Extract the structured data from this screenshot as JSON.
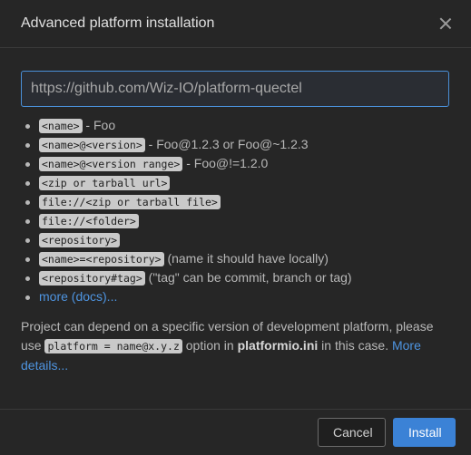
{
  "dialog": {
    "title": "Advanced platform installation",
    "url_value": "https://github.com/Wiz-IO/platform-quectel",
    "hints": [
      {
        "code": "<name>",
        "text": " - Foo"
      },
      {
        "code": "<name>@<version>",
        "text": " - Foo@1.2.3 or Foo@~1.2.3"
      },
      {
        "code": "<name>@<version range>",
        "text": " - Foo@!=1.2.0"
      },
      {
        "code": "<zip or tarball url>",
        "text": ""
      },
      {
        "code": "file://<zip or tarball file>",
        "text": ""
      },
      {
        "code": "file://<folder>",
        "text": ""
      },
      {
        "code": "<repository>",
        "text": ""
      },
      {
        "code": "<name>=<repository>",
        "text": " (name it should have locally)"
      },
      {
        "code": "<repository#tag>",
        "text": " (\"tag\" can be commit, branch or tag)"
      }
    ],
    "more_docs_link": "more (docs)...",
    "note": {
      "text1": "Project can depend on a specific version of development platform, please use ",
      "code": "platform = name@x.y.z",
      "text2": " option in ",
      "bold": "platformio.ini",
      "text3": " in this case. ",
      "link": "More details..."
    },
    "buttons": {
      "cancel": "Cancel",
      "install": "Install"
    }
  },
  "colors": {
    "background": "#262626",
    "accent": "#3b82d6",
    "link": "#4e94e0",
    "input_border": "#4a90d9"
  }
}
